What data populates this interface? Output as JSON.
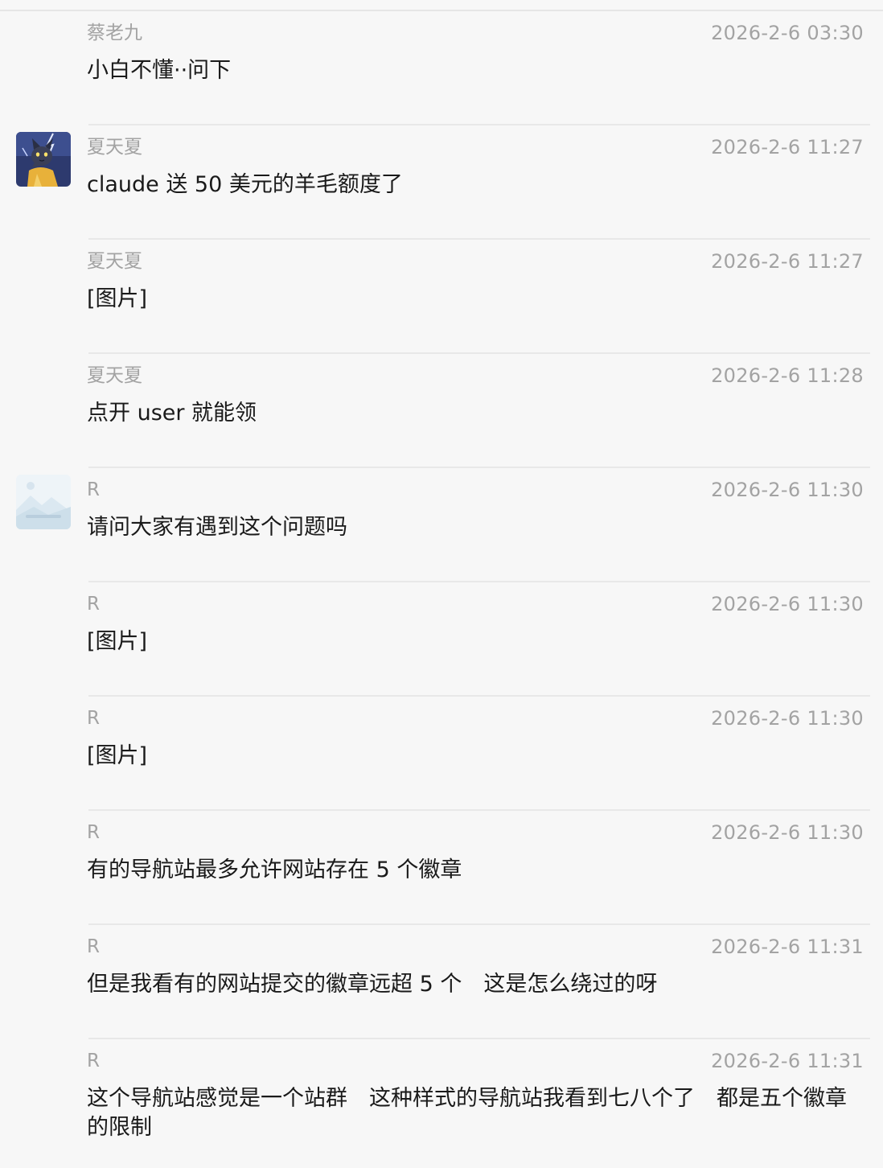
{
  "messages": [
    {
      "sender": "蔡老九",
      "time": "2026-2-6 03:30",
      "text": "小白不懂··问下",
      "avatar": null
    },
    {
      "sender": "夏天夏",
      "time": "2026-2-6 11:27",
      "text": "claude 送 50 美元的羊毛额度了",
      "avatar": "cat-cartoon-avatar"
    },
    {
      "sender": "夏天夏",
      "time": "2026-2-6 11:27",
      "text": "[图片]",
      "avatar": null
    },
    {
      "sender": "夏天夏",
      "time": "2026-2-6 11:28",
      "text": "点开 user 就能领",
      "avatar": null
    },
    {
      "sender": "R",
      "time": "2026-2-6 11:30",
      "text": "请问大家有遇到这个问题吗",
      "avatar": "image-placeholder-avatar"
    },
    {
      "sender": "R",
      "time": "2026-2-6 11:30",
      "text": "[图片]",
      "avatar": null
    },
    {
      "sender": "R",
      "time": "2026-2-6 11:30",
      "text": "[图片]",
      "avatar": null
    },
    {
      "sender": "R",
      "time": "2026-2-6 11:30",
      "text": "有的导航站最多允许网站存在 5 个徽章",
      "avatar": null
    },
    {
      "sender": "R",
      "time": "2026-2-6 11:31",
      "text": "但是我看有的网站提交的徽章远超 5 个　这是怎么绕过的呀",
      "avatar": null
    },
    {
      "sender": "R",
      "time": "2026-2-6 11:31",
      "text": "这个导航站感觉是一个站群　这种样式的导航站我看到七八个了　都是五个徽章的限制",
      "avatar": null
    }
  ],
  "colors": {
    "background": "#f7f7f7",
    "meta_text": "#a3a3a3",
    "body_text": "#1a1a1a",
    "divider": "#e8e8e8"
  }
}
